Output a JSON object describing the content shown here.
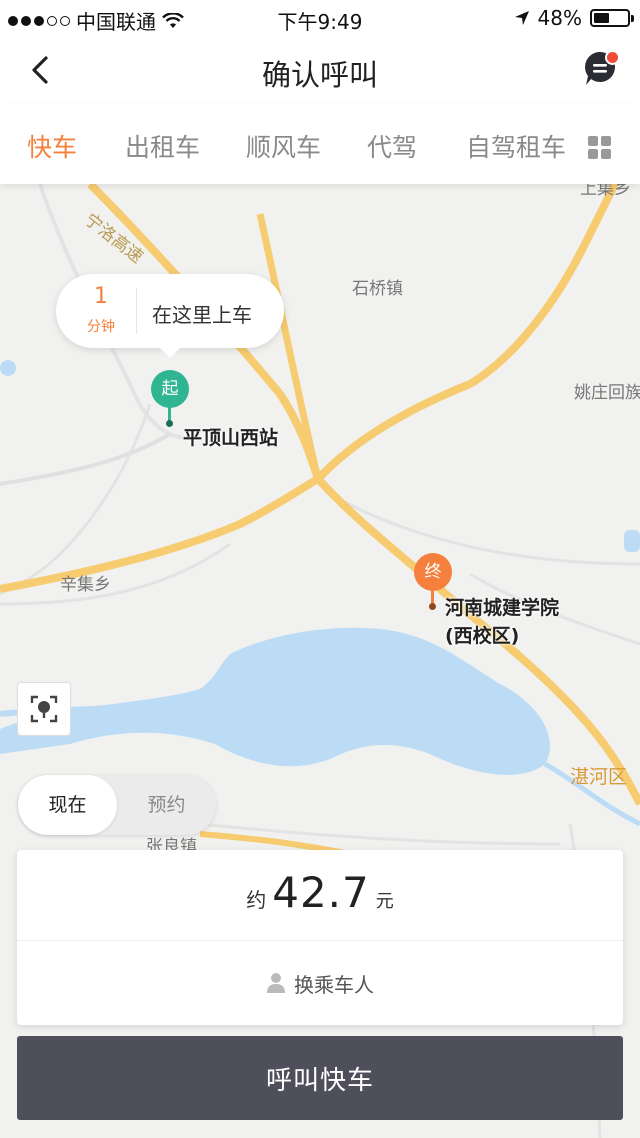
{
  "status_bar": {
    "carrier": "中国联通",
    "time": "下午9:49",
    "battery": "48%",
    "battery_level": 0.48
  },
  "nav": {
    "title": "确认呼叫",
    "back_icon": "chevron-left-icon",
    "message_icon": "message-bubble-icon"
  },
  "tabs": [
    {
      "label": "快车",
      "active": true
    },
    {
      "label": "出租车",
      "active": false
    },
    {
      "label": "顺风车",
      "active": false
    },
    {
      "label": "代驾",
      "active": false
    },
    {
      "label": "自驾租车",
      "active": false
    }
  ],
  "map": {
    "labels": {
      "expressway": "宁洛高速",
      "shiqiao": "石桥镇",
      "yaozhuang": "姚庄回族",
      "xinji": "辛集乡",
      "zhanghe": "湛河区",
      "zhangliang": "张良镇",
      "top_right": "上集乡"
    },
    "eta": {
      "number": "1",
      "unit": "分钟",
      "text": "在这里上车"
    },
    "start": {
      "marker": "起",
      "name": "平顶山西站"
    },
    "end": {
      "marker": "终",
      "name_line1": "河南城建学院",
      "name_line2": "(西校区)"
    },
    "colors": {
      "road": "#f7cb6f",
      "water": "#bcdcf5",
      "start_pin": "#2fb591",
      "end_pin": "#f5803e"
    }
  },
  "time_toggle": {
    "now": "现在",
    "reserve": "预约"
  },
  "fare": {
    "prefix": "约",
    "value": "42.7",
    "unit": "元",
    "change_rider": "换乘车人"
  },
  "call_button": "呼叫快车",
  "accent_color": "#f5803e"
}
